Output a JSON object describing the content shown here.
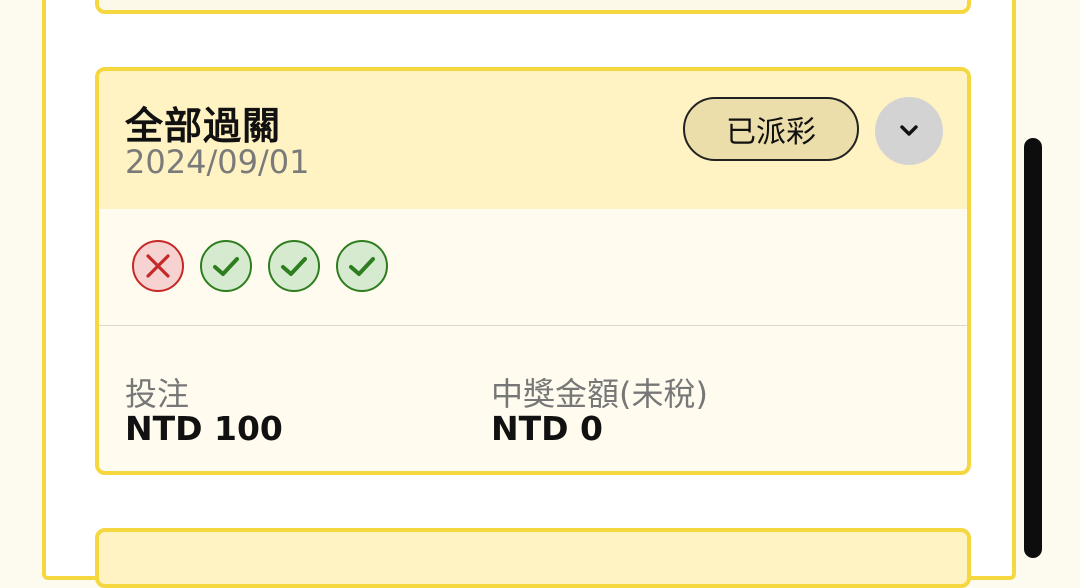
{
  "colors": {
    "accent_border": "#f5d73f",
    "card_header_bg": "#fff3c4",
    "badge_bg": "#ecdeaa",
    "win_green": "#2e7d1f",
    "lose_red": "#c62828"
  },
  "bet_card": {
    "title": "全部過關",
    "date": "2024/09/01",
    "status_badge": "已派彩",
    "expand_icon": "chevron-down-icon",
    "results": [
      {
        "status": "lose",
        "icon": "cross-circle-icon"
      },
      {
        "status": "win",
        "icon": "check-circle-icon"
      },
      {
        "status": "win",
        "icon": "check-circle-icon"
      },
      {
        "status": "win",
        "icon": "check-circle-icon"
      }
    ],
    "stake_label": "投注",
    "stake_value": "NTD 100",
    "payout_label": "中獎金額(未稅)",
    "payout_value": "NTD 0"
  }
}
